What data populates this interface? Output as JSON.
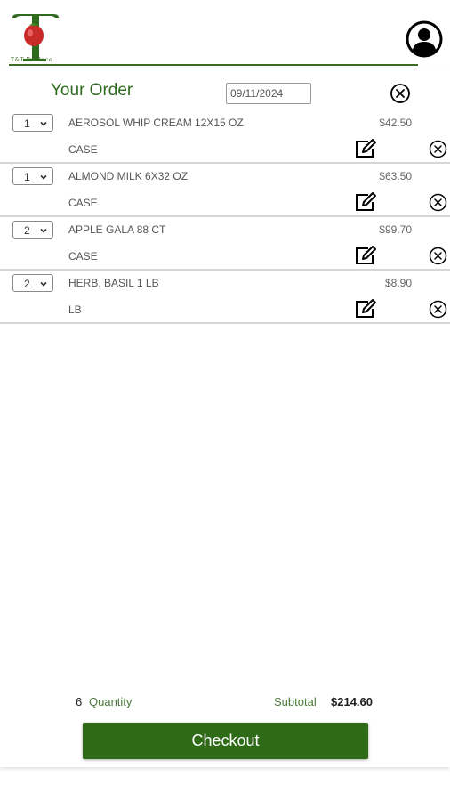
{
  "brand": {
    "name": "T&T Produce",
    "accent": "#2f6a17"
  },
  "header": {
    "profile_icon": "user-circle-icon"
  },
  "order": {
    "title": "Your Order",
    "date": "09/11/2024",
    "close_icon": "close-circle-icon"
  },
  "items": [
    {
      "qty": "1",
      "name": "AEROSOL WHIP CREAM 12X15 OZ",
      "price": "$42.50",
      "unit": "CASE"
    },
    {
      "qty": "1",
      "name": "ALMOND MILK 6X32 OZ",
      "price": "$63.50",
      "unit": "CASE"
    },
    {
      "qty": "2",
      "name": "APPLE GALA 88 CT",
      "price": "$99.70",
      "unit": "CASE"
    },
    {
      "qty": "2",
      "name": "HERB, BASIL 1 LB",
      "price": "$8.90",
      "unit": "LB"
    }
  ],
  "summary": {
    "quantity_count": "6",
    "quantity_label": "Quantity",
    "subtotal_label": "Subtotal",
    "subtotal_value": "$214.60"
  },
  "checkout": {
    "label": "Checkout"
  }
}
